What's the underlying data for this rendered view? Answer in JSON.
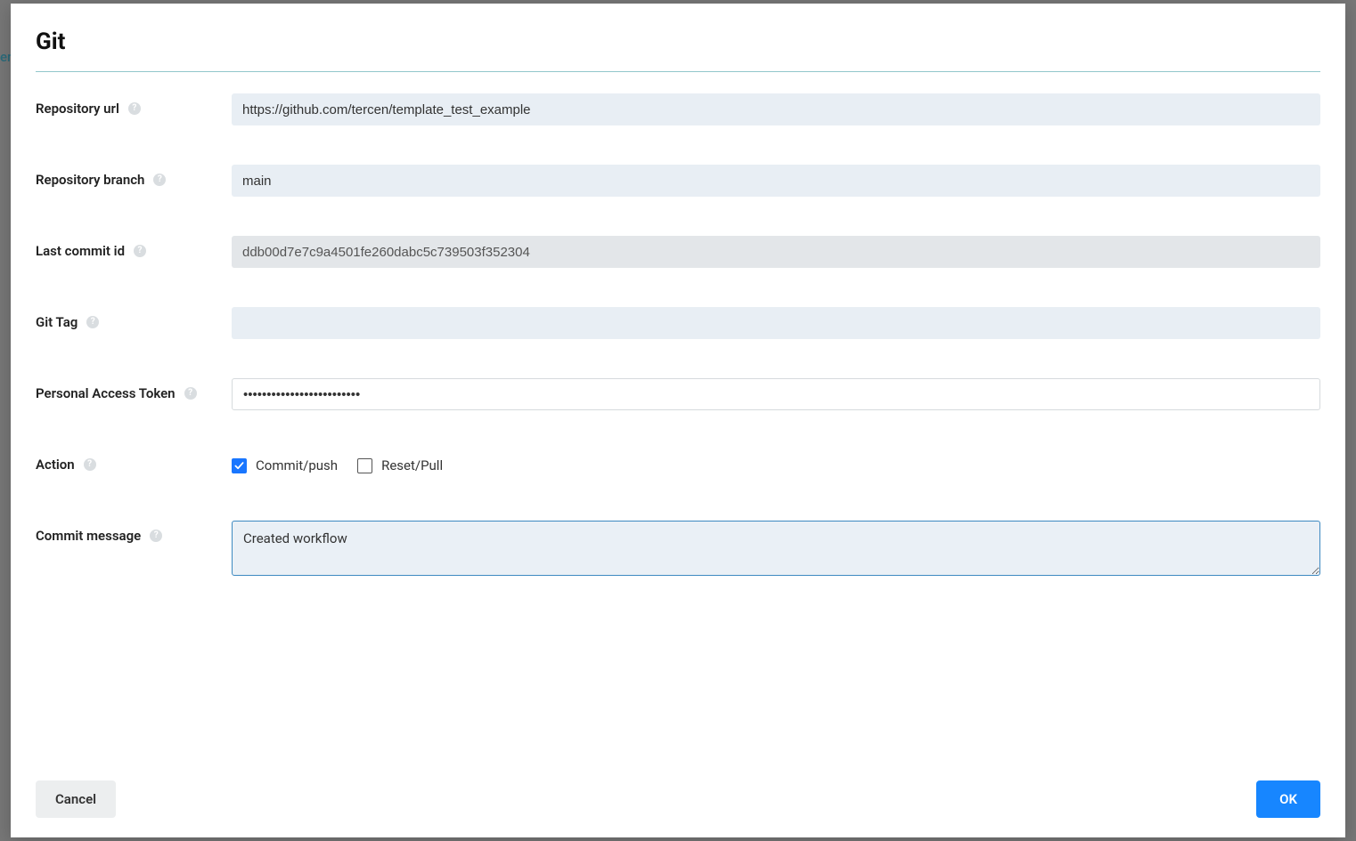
{
  "modal": {
    "title": "Git",
    "fields": {
      "repository_url": {
        "label": "Repository url",
        "value": "https://github.com/tercen/template_test_example"
      },
      "repository_branch": {
        "label": "Repository branch",
        "value": "main"
      },
      "last_commit_id": {
        "label": "Last commit id",
        "value": "ddb00d7e7c9a4501fe260dabc5c739503f352304"
      },
      "git_tag": {
        "label": "Git Tag",
        "value": ""
      },
      "personal_access_token": {
        "label": "Personal Access Token",
        "value": "•••••••••••••••••••••••••"
      },
      "action": {
        "label": "Action",
        "options": {
          "commit_push": {
            "label": "Commit/push",
            "checked": true
          },
          "reset_pull": {
            "label": "Reset/Pull",
            "checked": false
          }
        }
      },
      "commit_message": {
        "label": "Commit message",
        "value": "Created workflow"
      }
    },
    "buttons": {
      "cancel": "Cancel",
      "ok": "OK"
    }
  },
  "background_hint": "em"
}
